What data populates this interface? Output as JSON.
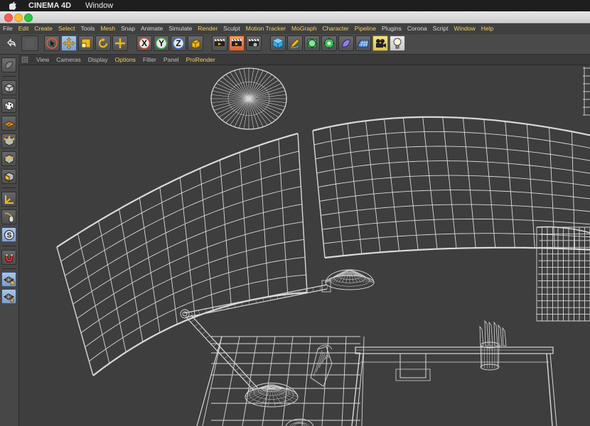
{
  "mac_menu": {
    "app_name": "CINEMA 4D",
    "window_menu": "Window"
  },
  "app_menu": [
    "File",
    "Edit",
    "Create",
    "Select",
    "Tools",
    "Mesh",
    "Snap",
    "Animate",
    "Simulate",
    "Render",
    "Sculpt",
    "Motion Tracker",
    "MoGraph",
    "Character",
    "Pipeline",
    "Plugins",
    "Corona",
    "Script",
    "Window",
    "Help"
  ],
  "app_menu_highlighted": [
    "Edit",
    "Create",
    "Select",
    "Mesh",
    "Render",
    "Motion Tracker",
    "MoGraph",
    "Character",
    "Pipeline",
    "Window",
    "Help"
  ],
  "viewport_menu": [
    "View",
    "Cameras",
    "Display",
    "Options",
    "Filter",
    "Panel",
    "ProRender"
  ],
  "viewport_menu_highlighted": [
    "Options",
    "ProRender"
  ],
  "toolbar": {
    "axis_x": "X",
    "axis_y": "Y",
    "axis_z": "Z",
    "icons": [
      "undo-icon",
      "redo-icon",
      "live-select-icon",
      "move-icon",
      "scale-icon",
      "rotate-icon",
      "transform-icon",
      "coordinate-system-icon",
      "render-view-icon",
      "render-picture-viewer-icon",
      "render-settings-icon",
      "cube-object-icon",
      "pen-spline-icon",
      "subdivision-icon",
      "cloner-icon",
      "deformer-icon",
      "floor-icon",
      "camera-icon",
      "light-icon"
    ]
  },
  "colors": {
    "menu_highlight": "#f4d35e",
    "active_tool": "#8fb0d8",
    "wireframe": "#d9d9d9",
    "viewport_bg": "#3e3e3e"
  }
}
